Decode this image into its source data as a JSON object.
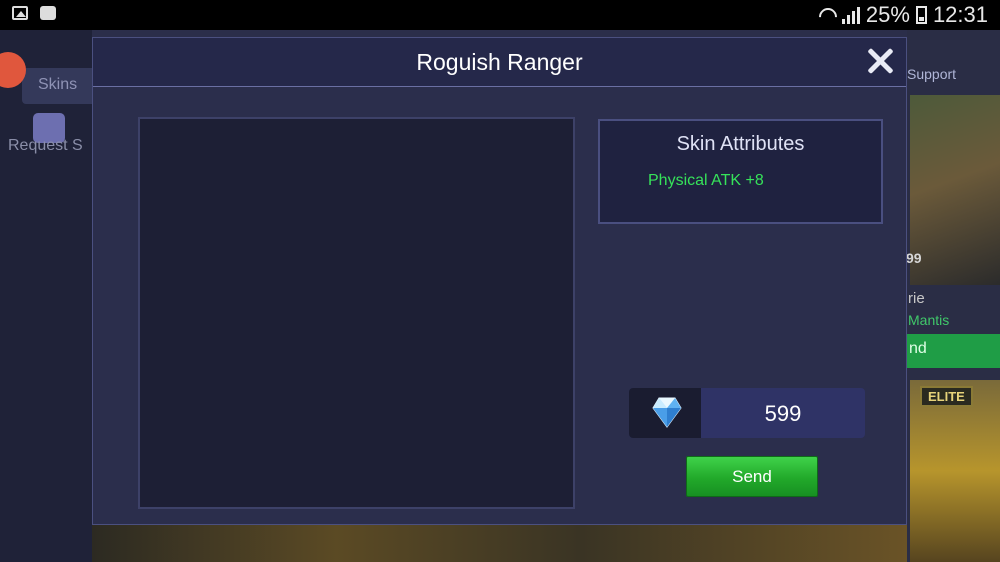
{
  "statusbar": {
    "battery": "25%",
    "time": "12:31",
    "icons": [
      "image-icon",
      "bbm-icon",
      "wifi-icon",
      "signal-icon",
      "battery-icon"
    ]
  },
  "background": {
    "tab_label": "Skins",
    "request_label": "Request S",
    "support_label": "Support",
    "price_partial": "99",
    "name_partial": "rie",
    "hero_partial": "Mantis",
    "button_partial": "nd",
    "elite_badge": "ELITE"
  },
  "modal": {
    "title": "Roguish Ranger",
    "close_icon": "close-icon",
    "attributes": {
      "title": "Skin Attributes",
      "lines": [
        "Physical ATK +8"
      ]
    },
    "price": {
      "currency_icon": "diamond-icon",
      "value": "599"
    },
    "send_label": "Send"
  },
  "colors": {
    "modal_bg": "#2b2e4c",
    "attribute_text": "#36e25a",
    "send_button": "#2bb33a"
  }
}
